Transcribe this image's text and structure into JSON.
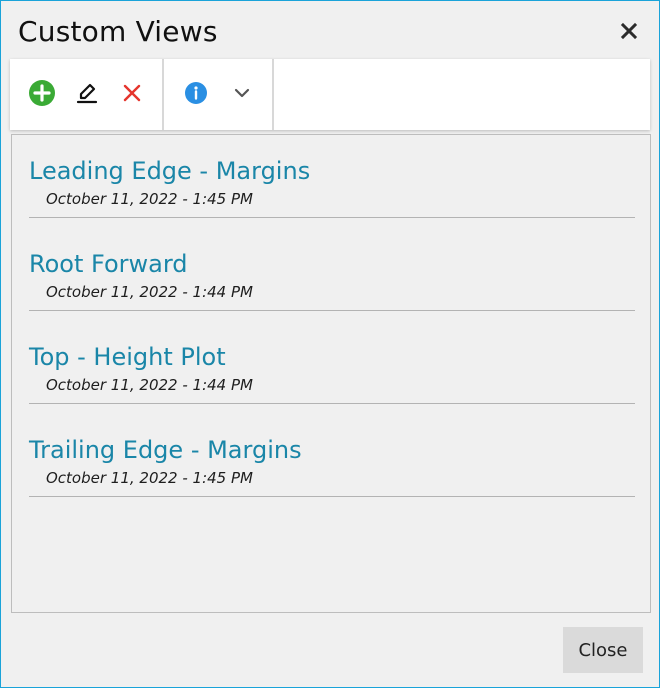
{
  "dialog": {
    "title": "Custom Views",
    "close_icon": "close-icon"
  },
  "toolbar": {
    "add_icon": "add-circle-icon",
    "edit_icon": "edit-pen-icon",
    "delete_icon": "delete-x-icon",
    "info_icon": "info-icon",
    "more_icon": "chevron-down-icon",
    "colors": {
      "add": "#3aaa35",
      "delete": "#e5352d",
      "info": "#2a8fe3"
    }
  },
  "views": [
    {
      "name": "Leading Edge - Margins",
      "date": "October 11, 2022 - 1:45 PM"
    },
    {
      "name": "Root Forward",
      "date": "October 11, 2022 - 1:44 PM"
    },
    {
      "name": "Top - Height Plot",
      "date": "October 11, 2022 - 1:44 PM"
    },
    {
      "name": "Trailing Edge - Margins",
      "date": "October 11, 2022 - 1:45 PM"
    }
  ],
  "footer": {
    "close_label": "Close"
  },
  "colors": {
    "link": "#1a86a8",
    "border_accent": "#1aa3d9"
  }
}
